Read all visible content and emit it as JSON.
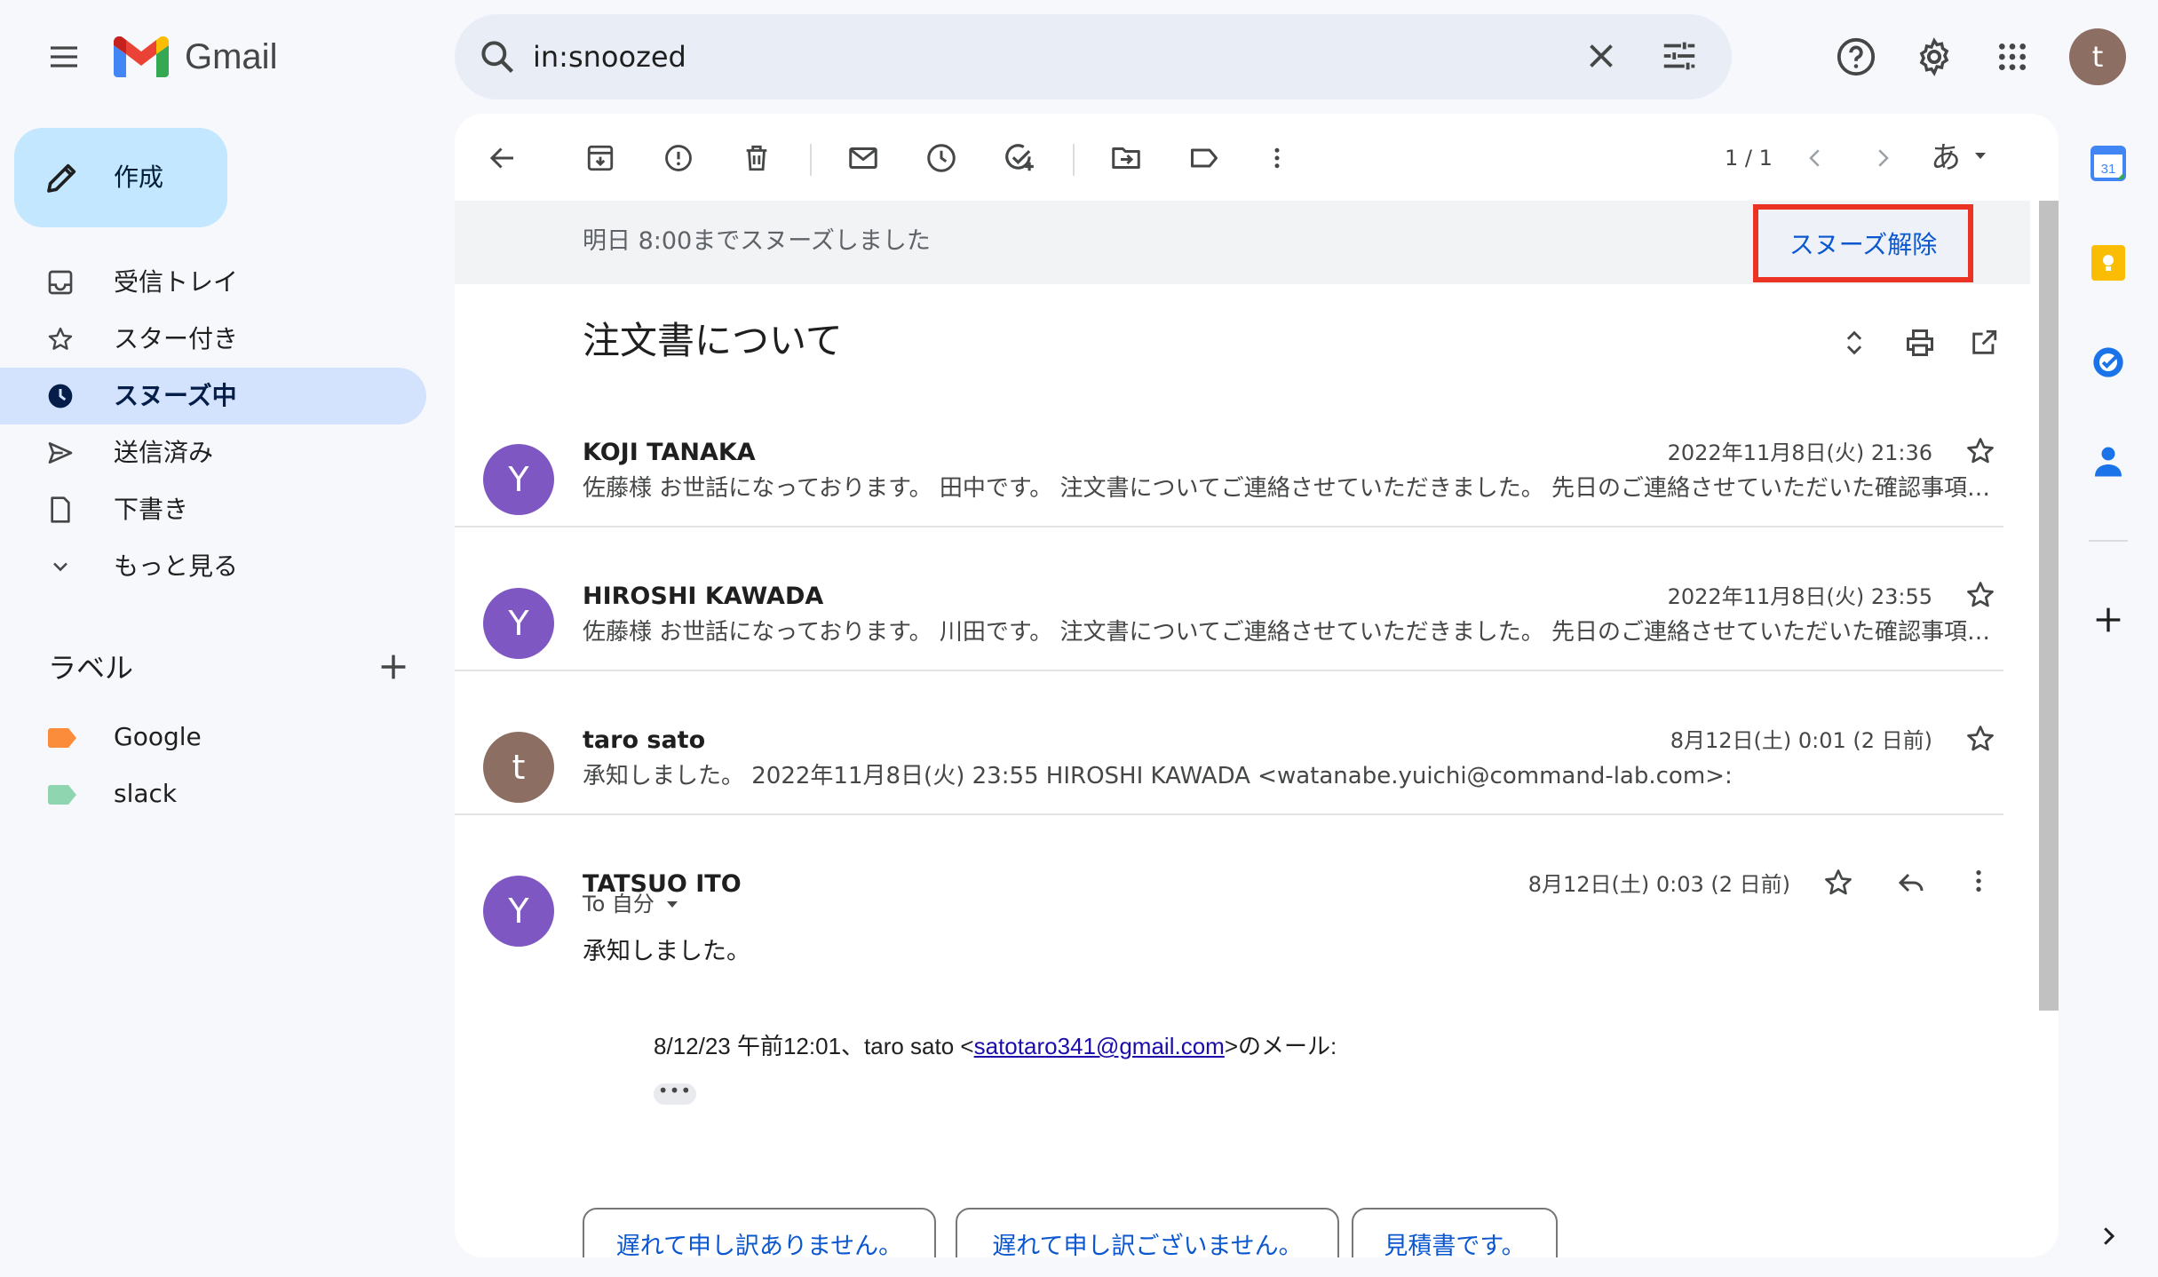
{
  "app": {
    "name": "Gmail"
  },
  "search": {
    "value": "in:snoozed"
  },
  "account": {
    "initial": "t"
  },
  "compose": {
    "label": "作成"
  },
  "nav": {
    "items": [
      {
        "label": "受信トレイ",
        "icon": "inbox-icon"
      },
      {
        "label": "スター付き",
        "icon": "star-icon"
      },
      {
        "label": "スヌーズ中",
        "icon": "clock-icon",
        "active": true
      },
      {
        "label": "送信済み",
        "icon": "send-icon"
      },
      {
        "label": "下書き",
        "icon": "draft-icon"
      },
      {
        "label": "もっと見る",
        "icon": "chevron-down-icon"
      }
    ]
  },
  "labels": {
    "title": "ラベル",
    "items": [
      {
        "name": "Google",
        "color": "#fb8c3c"
      },
      {
        "name": "slack",
        "color": "#8fd6b0"
      }
    ]
  },
  "toolbar": {
    "pager": "1 / 1",
    "ime": "あ"
  },
  "snooze": {
    "message": "明日 8:00までスヌーズしました",
    "unsnooze_label": "スヌーズ解除"
  },
  "thread": {
    "subject": "注文書について",
    "messages": [
      {
        "initial": "Y",
        "avatar_color": "#7e57c2",
        "sender": "KOJI TANAKA",
        "date": "2022年11月8日(火) 21:36",
        "snippet": "佐藤様 お世話になっております。 田中です。 注文書についてご連絡させていただきました。 先日のご連絡させていただいた確認事項につきまして"
      },
      {
        "initial": "Y",
        "avatar_color": "#7e57c2",
        "sender": "HIROSHI KAWADA",
        "date": "2022年11月8日(火) 23:55",
        "snippet": "佐藤様 お世話になっております。 川田です。 注文書についてご連絡させていただきました。 先日のご連絡させていただいた確認事項につきまして"
      },
      {
        "initial": "t",
        "avatar_color": "#8d6e63",
        "sender": "taro sato",
        "date": "8月12日(土) 0:01 (2 日前)",
        "snippet": "承知しました。 2022年11月8日(火) 23:55 HIROSHI KAWADA <watanabe.yuichi@command-lab.com>:"
      },
      {
        "initial": "Y",
        "avatar_color": "#7e57c2",
        "sender": "TATSUO ITO",
        "date": "8月12日(土) 0:03 (2 日前)",
        "to": "To 自分",
        "body": "承知しました。",
        "quote_prefix": "8/12/23 午前12:01、taro sato <",
        "quote_email": "satotaro341@gmail.com",
        "quote_suffix": ">のメール:",
        "more": "•••"
      }
    ]
  },
  "smart_replies": [
    "遅れて申し訳ありません。",
    "遅れて申し訳ございません。",
    "見積書です。"
  ],
  "side_panel": {
    "calendar_day": "31"
  },
  "colors": {
    "compose_bg": "#c2e7ff",
    "active_nav_bg": "#d3e3fd",
    "highlight_border": "#ea3323",
    "link_blue": "#0b57d0"
  }
}
